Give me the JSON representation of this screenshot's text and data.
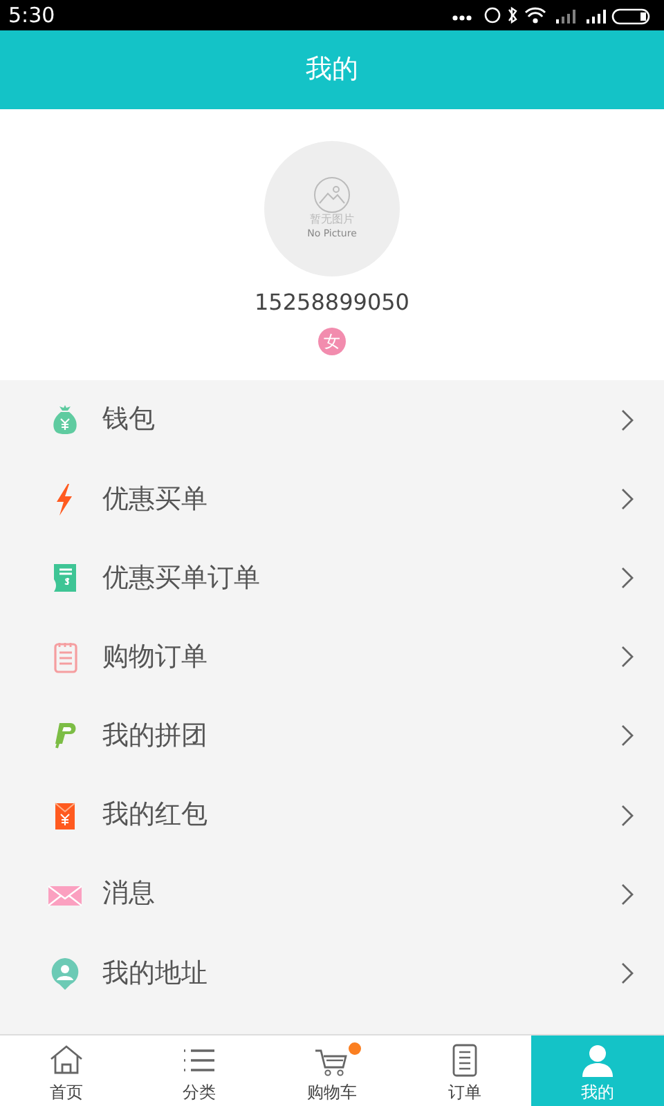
{
  "status_bar": {
    "time": "5:30"
  },
  "header": {
    "title": "我的"
  },
  "profile": {
    "avatar_text": "暂无图片",
    "avatar_subtext": "No Picture",
    "phone": "15258899050",
    "gender": "女"
  },
  "menu": [
    {
      "kind": "wallet",
      "label": "钱包"
    },
    {
      "kind": "flash",
      "label": "优惠买单"
    },
    {
      "kind": "bill",
      "label": "优惠买单订单"
    },
    {
      "kind": "list",
      "label": "购物订单"
    },
    {
      "kind": "group",
      "label": "我的拼团"
    },
    {
      "kind": "redpacket",
      "label": "我的红包"
    },
    {
      "kind": "mail",
      "label": "消息"
    },
    {
      "kind": "address",
      "label": "我的地址"
    }
  ],
  "tabs": [
    {
      "kind": "home",
      "label": "首页",
      "selected": false,
      "badge": false
    },
    {
      "kind": "category",
      "label": "分类",
      "selected": false,
      "badge": false
    },
    {
      "kind": "cart",
      "label": "购物车",
      "selected": false,
      "badge": true
    },
    {
      "kind": "orders",
      "label": "订单",
      "selected": false,
      "badge": false
    },
    {
      "kind": "user",
      "label": "我的",
      "selected": true,
      "badge": false
    }
  ]
}
